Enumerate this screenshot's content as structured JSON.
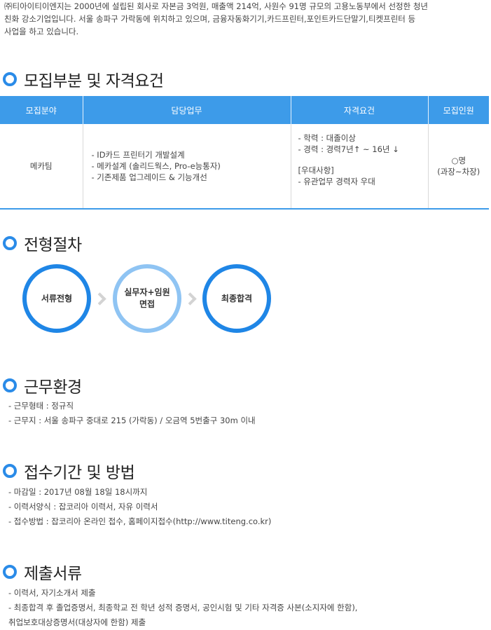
{
  "intro": {
    "line1": "㈜티아이티이엔지는 2000년에 설립된 회사로 자본금 3억원, 매출액 214억, 사원수 91명 규모의 고용노동부에서 선정한 청년",
    "line2": "친화 강소기업입니다. 서울 송파구 가락동에 위치하고 있으며, 금융자동화기기,카드프린터,포인트카드단말기,티켓프린터 등",
    "line3": "사업을 하고 있습니다."
  },
  "sections": {
    "recruit": "모집부분 및 자격요건",
    "process": "전형절차",
    "environment": "근무환경",
    "apply": "접수기간 및 방법",
    "documents": "제출서류"
  },
  "table": {
    "headers": [
      "모집분야",
      "담당업무",
      "자격요건",
      "모집인원"
    ],
    "field": "메카팀",
    "duties": [
      "- ID카드 프린터기 개발설계",
      "- 메카설계 (솔리드웍스, Pro-e능통자)",
      "- 기존제품 업그레이드 & 기능개선"
    ],
    "requirements": [
      "- 학력 : 대졸이상",
      "- 경력 : 경력7년↑ ~ 16년 ↓",
      "",
      "[우대사항]",
      "- 유관업무 경력자 우대"
    ],
    "headcount_line1": "○명",
    "headcount_line2": "(과장~차장)"
  },
  "process_steps": {
    "step1": "서류전형",
    "step2_line1": "실무자+임원",
    "step2_line2": "면접",
    "step3": "최종합격"
  },
  "environment": {
    "type": "- 근무형태 : 정규직",
    "location": "- 근무지 : 서울 송파구 중대로 215 (가락동) / 오금역 5번출구 30m 이내"
  },
  "apply": {
    "deadline": "- 마감일 : 2017년 08월 18일 18시까지",
    "form": "- 이력서양식 : 잡코리아 이력서, 자유 이력서",
    "method": "- 접수방법 : 잡코리아 온라인 접수, 홈페이지접수(http://www.titeng.co.kr)"
  },
  "documents": {
    "line1": "- 이력서, 자기소개서 제출",
    "line2": "- 최종합격 후 졸업증명서, 최종학교 전 학년 성적 증명서, 공인시험 및 기타 자격증 사본(소지자에 한함),",
    "line3": "취업보호대상증명서(대상자에 한함) 제출"
  },
  "colors": {
    "accent": "#2a8be8",
    "header_bg": "#3d9be9",
    "light_ring": "#8fc4f3",
    "chevron": "#d3d3d3"
  }
}
